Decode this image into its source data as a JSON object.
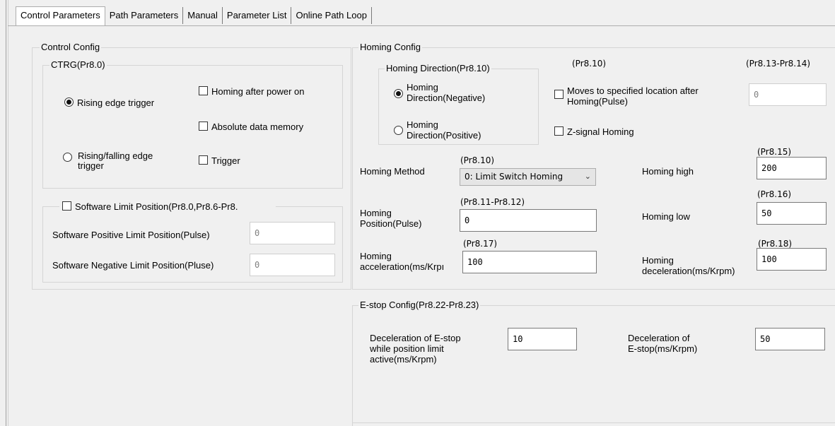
{
  "tabs": [
    "Control Parameters",
    "Path Parameters",
    "Manual",
    "Parameter List",
    "Online Path Loop"
  ],
  "control_config": {
    "title": "Control Config",
    "ctrg": {
      "title": "CTRG(Pr8.0)",
      "rising_edge": "Rising edge trigger",
      "rising_falling_1": "Rising/falling edge",
      "rising_falling_2": "trigger",
      "selected": "rising_edge"
    },
    "homing_after_power": "Homing after power on",
    "absolute_data": "Absolute data memory",
    "trigger": "Trigger",
    "software_limit": {
      "title": "Software Limit Position(Pr8.0,Pr8.6-Pr8.",
      "positive_label": "Software Positive Limit Position(Pulse)",
      "positive_value": "0",
      "negative_label": "Software Negative Limit Position(Pluse)",
      "negative_value": "0"
    }
  },
  "homing_config": {
    "title": "Homing Config",
    "direction": {
      "title": "Homing Direction(Pr8.10)",
      "negative_1": "Homing",
      "negative_2": "Direction(Negative)",
      "positive_1": "Homing",
      "positive_2": "Direction(Positive)",
      "selected": "negative"
    },
    "pr_810_top": "(Pr8.10)",
    "pr_813_814": "(Pr8.13-Pr8.14)",
    "moves_1": "Moves to specified location after",
    "moves_2": "Homing(Pulse)",
    "moves_value": "0",
    "z_signal": "Z-signal Homing",
    "method_pr": "(Pr8.10)",
    "method_label": "Homing Method",
    "method_value": "0: Limit Switch Homing",
    "position_pr": "(Pr8.11-Pr8.12)",
    "position_label_1": "Homing",
    "position_label_2": "Position(Pulse)",
    "position_value": "0",
    "accel_pr": "(Pr8.17)",
    "accel_label_1": "Homing",
    "accel_label_2": "acceleration(ms/Krpı",
    "accel_value": "100",
    "high_pr": "(Pr8.15)",
    "high_label": "Homing high",
    "high_value": "200",
    "low_pr": "(Pr8.16)",
    "low_label": "Homing low",
    "low_value": "50",
    "decel_pr": "(Pr8.18)",
    "decel_label_1": "Homing",
    "decel_label_2": "deceleration(ms/Krpm)",
    "decel_value": "100"
  },
  "estop_config": {
    "title": "E-stop Config(Pr8.22-Pr8.23)",
    "limit_label_1": "Deceleration of E-stop",
    "limit_label_2": "while position limit",
    "limit_label_3": "active(ms/Krpm)",
    "limit_value": "10",
    "decel_label_1": "Deceleration of",
    "decel_label_2": "E-stop(ms/Krpm)",
    "decel_value": "50"
  }
}
